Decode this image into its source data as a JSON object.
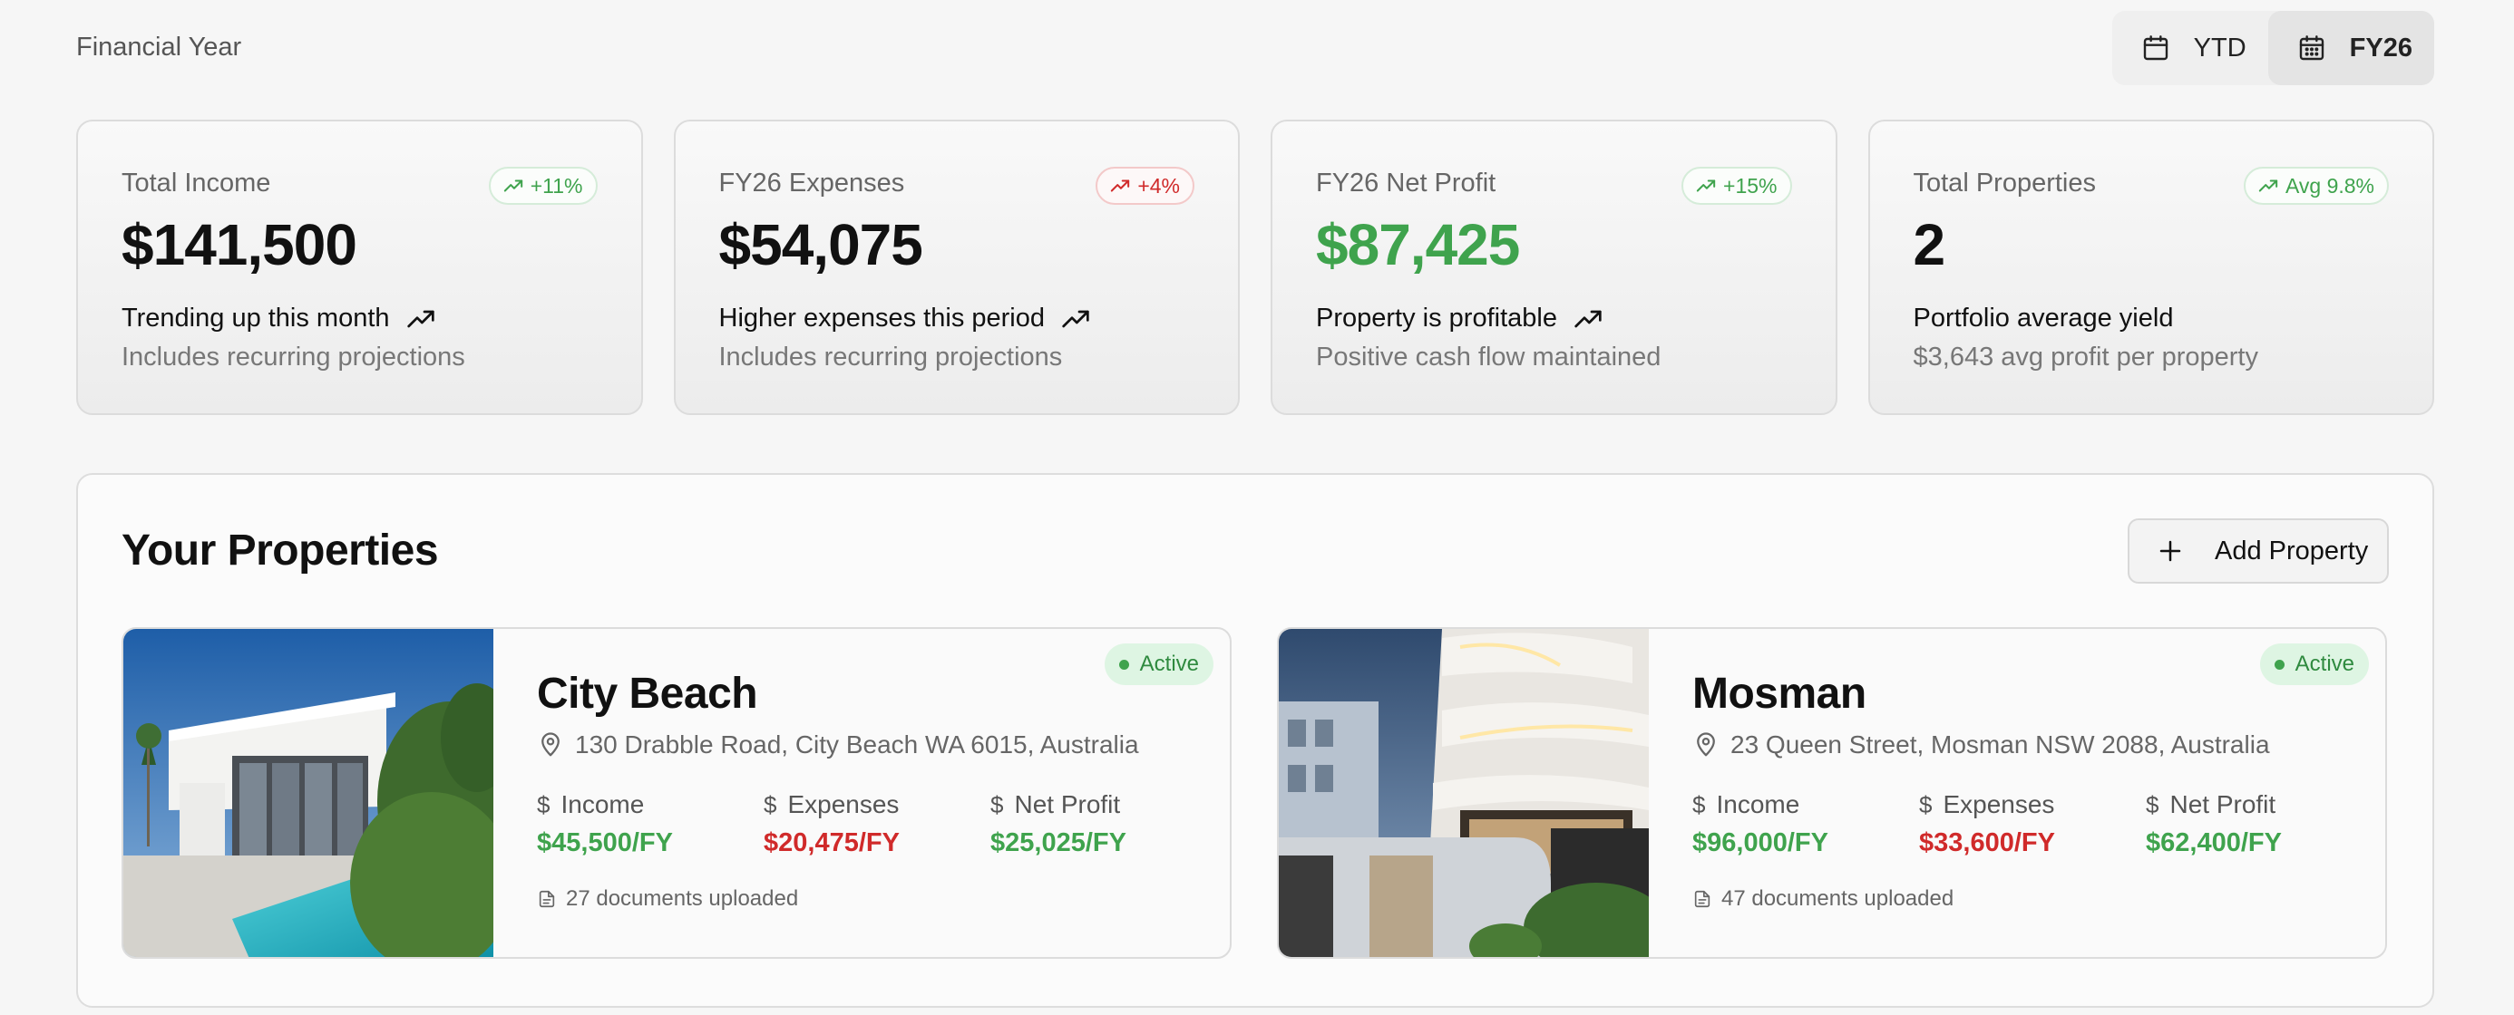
{
  "header": {
    "label": "Financial Year",
    "toggle": [
      {
        "label": "YTD",
        "icon": "calendar-icon",
        "active": false
      },
      {
        "label": "FY26",
        "icon": "calendar-icon",
        "active": true
      }
    ]
  },
  "stats": [
    {
      "title": "Total Income",
      "value": "$141,500",
      "badge": "+11%",
      "trend_line": "Trending up this month",
      "sub": "Includes recurring projections"
    },
    {
      "title": "FY26 Expenses",
      "value": "$54,075",
      "badge": "+4%",
      "trend_line": "Higher expenses this period",
      "sub": "Includes recurring projections"
    },
    {
      "title": "FY26 Net Profit",
      "value": "$87,425",
      "badge": "+15%",
      "trend_line": "Property is profitable",
      "sub": "Positive cash flow maintained"
    },
    {
      "title": "Total Properties",
      "value": "2",
      "badge": "Avg 9.8%",
      "trend_line": "Portfolio average yield",
      "sub": "$3,643 avg profit per property"
    }
  ],
  "colors": {
    "green": "#3fa34d",
    "red": "#d02a2a",
    "status_bg": "#def5e3"
  },
  "properties_section": {
    "title": "Your Properties",
    "add_button": "Add Property",
    "items": [
      {
        "name": "City Beach",
        "address": "130 Drabble Road, City Beach WA 6015, Australia",
        "status": "Active",
        "income_label": "Income",
        "income": "$45,500/FY",
        "expenses_label": "Expenses",
        "expenses": "$20,475/FY",
        "profit_label": "Net Profit",
        "profit": "$25,025/FY",
        "currency_symbol": "$",
        "docs": "27 documents uploaded"
      },
      {
        "name": "Mosman",
        "address": "23 Queen Street, Mosman NSW 2088, Australia",
        "status": "Active",
        "income_label": "Income",
        "income": "$96,000/FY",
        "expenses_label": "Expenses",
        "expenses": "$33,600/FY",
        "profit_label": "Net Profit",
        "profit": "$62,400/FY",
        "currency_symbol": "$",
        "docs": "47 documents uploaded"
      }
    ]
  }
}
